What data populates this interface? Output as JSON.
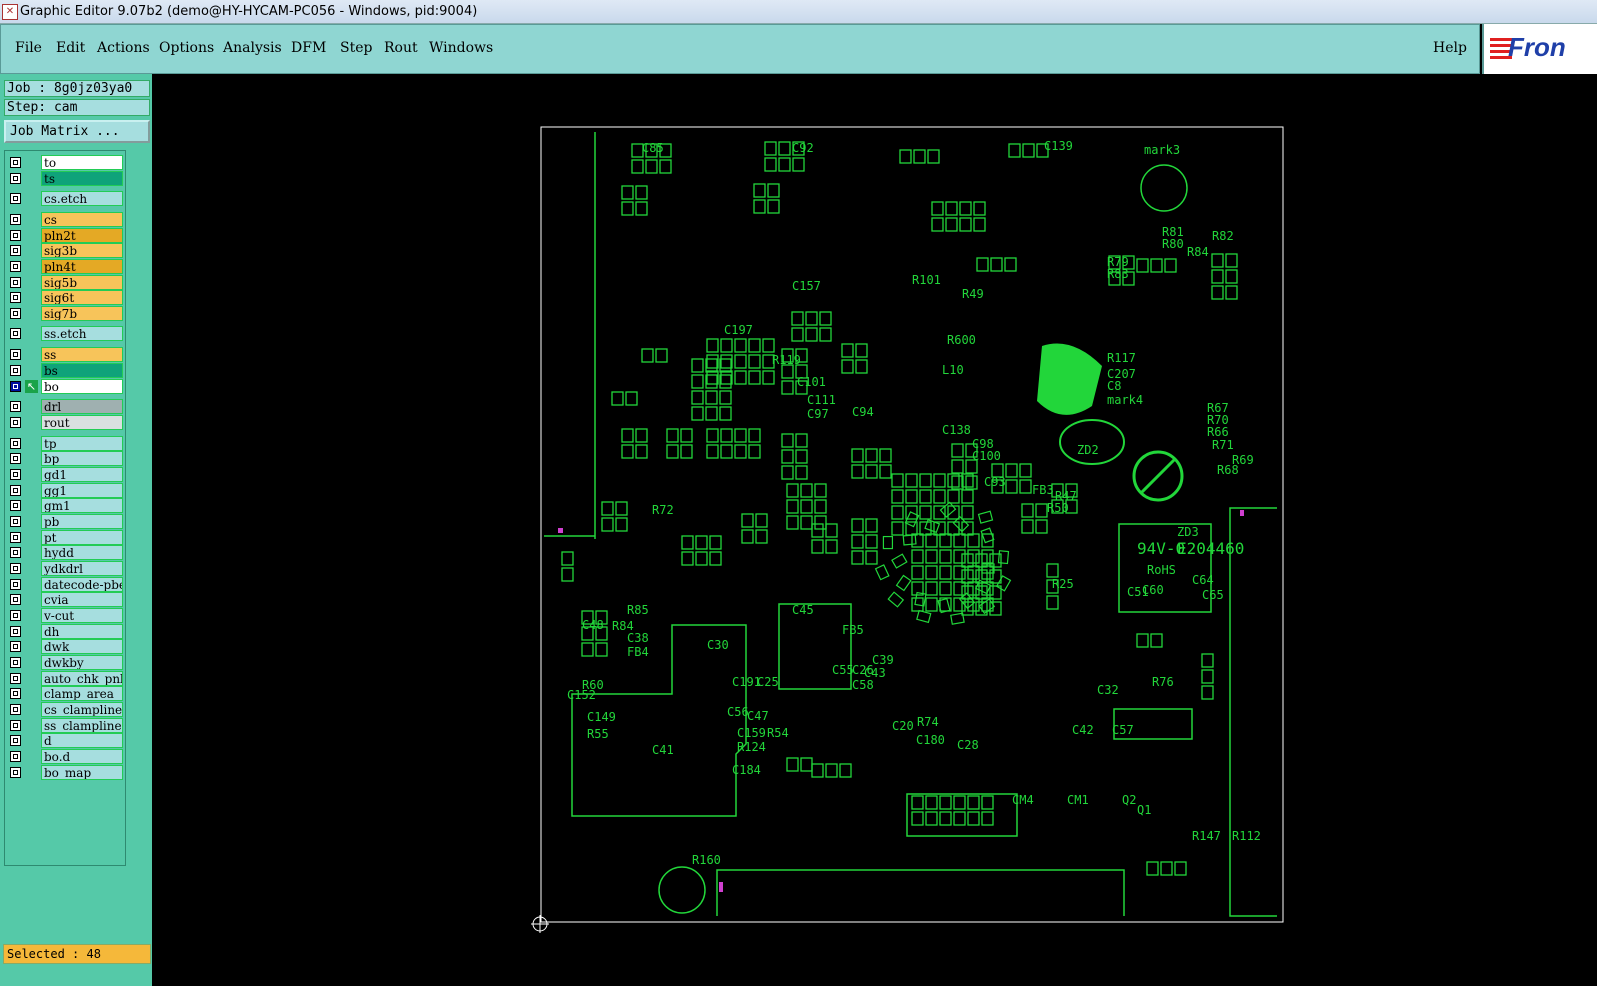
{
  "window": {
    "title": "Graphic Editor 9.07b2 (demo@HY-HYCAM-PC056 - Windows, pid:9004)"
  },
  "menu": {
    "items": [
      "File",
      "Edit",
      "Actions",
      "Options",
      "Analysis",
      "DFM",
      "Step",
      "Rout",
      "Windows"
    ],
    "help": "Help"
  },
  "logo": {
    "text": "Fron"
  },
  "job": {
    "job_label": "Job : 8g0jz03ya0",
    "step_label": "Step: cam",
    "matrix_button": "Job Matrix ..."
  },
  "layers": [
    {
      "name": "to",
      "color": "#ffffff"
    },
    {
      "name": "ts",
      "color": "#0fa37a"
    },
    {
      "name": "cs.etch",
      "color": "#a6dedf"
    },
    {
      "name": "cs",
      "color": "#f7c45a"
    },
    {
      "name": "pln2t",
      "color": "#e4a925"
    },
    {
      "name": "sig3b",
      "color": "#f7c45a"
    },
    {
      "name": "pln4t",
      "color": "#e4a925"
    },
    {
      "name": "sig5b",
      "color": "#f7c45a"
    },
    {
      "name": "sig6t",
      "color": "#f7c45a"
    },
    {
      "name": "sig7b",
      "color": "#f7c45a"
    },
    {
      "name": "ss.etch",
      "color": "#a6dedf"
    },
    {
      "name": "ss",
      "color": "#f7c45a"
    },
    {
      "name": "bs",
      "color": "#0fa37a"
    },
    {
      "name": "bo",
      "color": "#ffffff",
      "selected": true
    },
    {
      "name": "drl",
      "color": "#9fb0b0"
    },
    {
      "name": "rout",
      "color": "#d9e0e0"
    },
    {
      "name": "tp",
      "color": "#a6dedf"
    },
    {
      "name": "bp",
      "color": "#a6dedf"
    },
    {
      "name": "gd1",
      "color": "#a6dedf"
    },
    {
      "name": "gg1",
      "color": "#a6dedf"
    },
    {
      "name": "gm1",
      "color": "#a6dedf"
    },
    {
      "name": "pb",
      "color": "#a6dedf"
    },
    {
      "name": "pt",
      "color": "#a6dedf"
    },
    {
      "name": "hydd",
      "color": "#a6dedf"
    },
    {
      "name": "ydkdrl",
      "color": "#a6dedf"
    },
    {
      "name": "datecode-pbe",
      "color": "#a6dedf"
    },
    {
      "name": "cvia",
      "color": "#a6dedf"
    },
    {
      "name": "v-cut",
      "color": "#a6dedf"
    },
    {
      "name": "dh",
      "color": "#a6dedf"
    },
    {
      "name": "dwk",
      "color": "#a6dedf"
    },
    {
      "name": "dwkby",
      "color": "#a6dedf"
    },
    {
      "name": "auto_chk_pnl",
      "color": "#a6dedf"
    },
    {
      "name": "clamp_area",
      "color": "#a6dedf"
    },
    {
      "name": "cs_clampline",
      "color": "#a6dedf"
    },
    {
      "name": "ss_clampline",
      "color": "#a6dedf"
    },
    {
      "name": "d",
      "color": "#a6dedf"
    },
    {
      "name": "bo.d",
      "color": "#a6dedf"
    },
    {
      "name": "bo_map",
      "color": "#a6dedf"
    }
  ],
  "status": {
    "selected": "Selected : 48"
  },
  "canvas": {
    "colors": {
      "feature": "#22d63a",
      "outline": "#ffffff",
      "marker": "#d040d0"
    },
    "labels": [
      "C85",
      "C92",
      "C139",
      "mark3",
      "R81",
      "R82",
      "R80",
      "R84",
      "R79",
      "R83",
      "R101",
      "R49",
      "C157",
      "C197",
      "R119",
      "C111",
      "C101",
      "C97",
      "C94",
      "C138",
      "C98",
      "C100",
      "C93",
      "FB3",
      "R47",
      "R50",
      "R25",
      "R76",
      "R85",
      "R84",
      "C48",
      "C38",
      "FB4",
      "C191",
      "R60",
      "C152",
      "C149",
      "R55",
      "R54",
      "C159",
      "R124",
      "C25",
      "C30",
      "C56",
      "C41",
      "C47",
      "C45",
      "C39",
      "C43",
      "C184",
      "C20",
      "C28",
      "C32",
      "R72",
      "R74",
      "C180",
      "CM4",
      "CM1",
      "Q2",
      "Q1",
      "R147",
      "R112",
      "R160",
      "R117",
      "C207",
      "C8",
      "mark4",
      "R67",
      "R70",
      "R66",
      "R71",
      "R68",
      "R69",
      "R600",
      "L10",
      "ZD2",
      "ZD3",
      "E204460",
      "94V-0",
      "RoHS",
      "C60",
      "C64",
      "C65",
      "C51",
      "FB5",
      "C55",
      "C26",
      "C58",
      "C42",
      "C57"
    ]
  }
}
